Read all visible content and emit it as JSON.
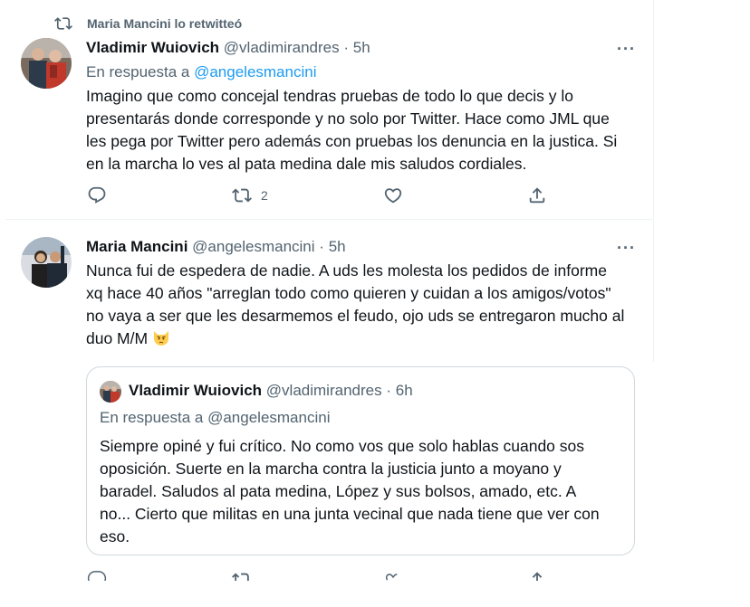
{
  "retweet_banner": {
    "text": "Maria Mancini lo retwitteó",
    "icon": "retweet-icon"
  },
  "tweet1": {
    "name": "Vladimir Wuiovich",
    "handle": "@vladimirandres",
    "separator": "·",
    "time": "5h",
    "reply_prefix": "En respuesta a",
    "reply_handle": "@angelesmancini",
    "lines": [
      "Imagino que como concejal tendras pruebas de todo lo que decis y lo",
      "presentarás donde corresponde y no solo por Twitter. Hace como JML que",
      "les pega por Twitter pero además con pruebas los denuncia en la justica. Si",
      "en la marcha lo ves al pata medina dale mis saludos cordiales."
    ],
    "more": "···",
    "actions": {
      "reply": "",
      "retweet": "2",
      "like": "",
      "share": ""
    }
  },
  "tweet2": {
    "name": "Maria Mancini",
    "handle": "@angelesmancini",
    "separator": "·",
    "time": "5h",
    "lines": [
      "Nunca fui de espedera de nadie. A uds les molesta los pedidos de informe",
      "xq hace 40 años \"arreglan todo como quieren y cuidan a los amigos/votos\"",
      "no vaya a ser que les desarmemos el feudo, ojo uds se entregaron mucho al",
      "duo M/M"
    ],
    "emoji": "pouting-cat-emoji",
    "more": "···"
  },
  "quote": {
    "name": "Vladimir Wuiovich",
    "handle": "@vladimirandres",
    "separator": "·",
    "time": "6h",
    "reply_prefix": "En respuesta a",
    "reply_handle": "@angelesmancini",
    "lines": [
      "Siempre opiné y fui crítico. No como vos que solo hablas cuando sos",
      "oposición. Suerte en la marcha contra la justicia junto a moyano y",
      "baradel. Saludos al pata medina, López y sus bolsos, amado, etc. A",
      "no... Cierto que militas en una junta vecinal que nada tiene que ver con",
      "eso."
    ]
  },
  "colors": {
    "accent": "#1d9bf0",
    "muted": "#536471",
    "text": "#0f1419",
    "border": "#cfd9de"
  }
}
